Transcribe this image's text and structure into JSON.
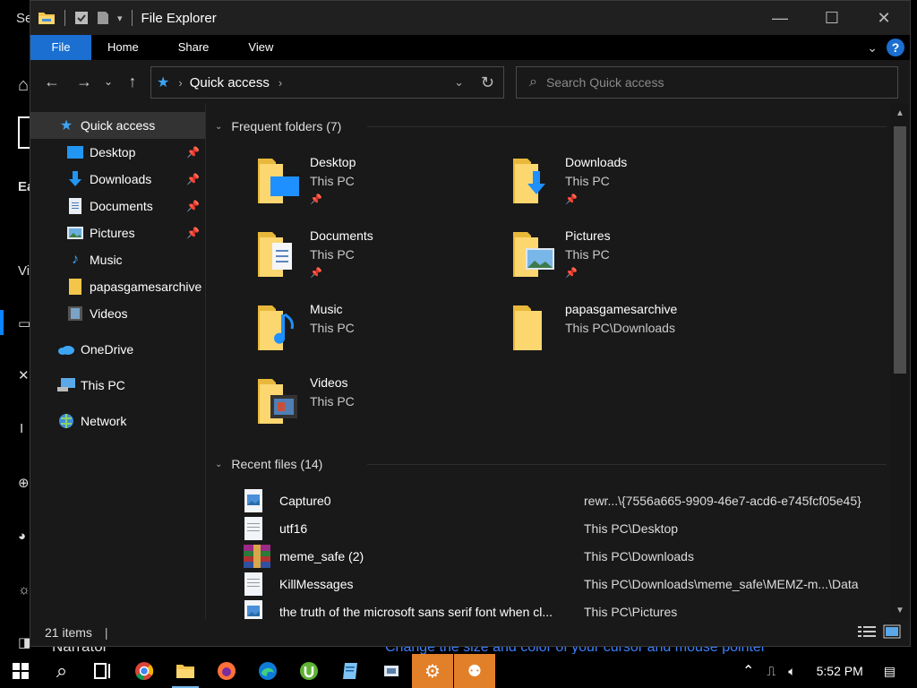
{
  "background": {
    "peek_labels": [
      "Se",
      "Ea",
      "Vi"
    ],
    "link_text": "Change the size and color of your cursor and mouse pointer",
    "narrator": "Narrator"
  },
  "window": {
    "title": "File Explorer",
    "ribbon_tabs": [
      "File",
      "Home",
      "Share",
      "View"
    ],
    "help_label": "?"
  },
  "address": {
    "crumb": "Quick access",
    "search_placeholder": "Search Quick access"
  },
  "sidebar": {
    "items": [
      {
        "label": "Quick access",
        "icon": "star-icon",
        "level": 0,
        "active": true,
        "pinned": false
      },
      {
        "label": "Desktop",
        "icon": "desktop-icon",
        "level": 1,
        "active": false,
        "pinned": true
      },
      {
        "label": "Downloads",
        "icon": "download-arrow-icon",
        "level": 1,
        "active": false,
        "pinned": true
      },
      {
        "label": "Documents",
        "icon": "document-icon",
        "level": 1,
        "active": false,
        "pinned": true
      },
      {
        "label": "Pictures",
        "icon": "pictures-icon",
        "level": 1,
        "active": false,
        "pinned": true
      },
      {
        "label": "Music",
        "icon": "music-note-icon",
        "level": 1,
        "active": false,
        "pinned": false
      },
      {
        "label": "papasgamesarchive",
        "icon": "folder-icon",
        "level": 1,
        "active": false,
        "pinned": false
      },
      {
        "label": "Videos",
        "icon": "film-icon",
        "level": 1,
        "active": false,
        "pinned": false
      },
      {
        "label": "OneDrive",
        "icon": "cloud-icon",
        "level": 0,
        "active": false,
        "pinned": false
      },
      {
        "label": "This PC",
        "icon": "computer-icon",
        "level": 0,
        "active": false,
        "pinned": false
      },
      {
        "label": "Network",
        "icon": "network-icon",
        "level": 0,
        "active": false,
        "pinned": false
      }
    ]
  },
  "frequent": {
    "heading": "Frequent folders (7)",
    "folders": [
      {
        "name": "Desktop",
        "location": "This PC",
        "pinned": true,
        "overlay": "desktop"
      },
      {
        "name": "Downloads",
        "location": "This PC",
        "pinned": true,
        "overlay": "download"
      },
      {
        "name": "Documents",
        "location": "This PC",
        "pinned": true,
        "overlay": "document"
      },
      {
        "name": "Pictures",
        "location": "This PC",
        "pinned": true,
        "overlay": "picture"
      },
      {
        "name": "Music",
        "location": "This PC",
        "pinned": false,
        "overlay": "music"
      },
      {
        "name": "papasgamesarchive",
        "location": "This PC\\Downloads",
        "pinned": false,
        "overlay": "none"
      },
      {
        "name": "Videos",
        "location": "This PC",
        "pinned": false,
        "overlay": "video"
      }
    ]
  },
  "recent": {
    "heading": "Recent files (14)",
    "files": [
      {
        "name": "Capture0",
        "path": "rewr...\\{7556a665-9909-46e7-acd6-e745fcf05e45}",
        "icon": "image-file-icon"
      },
      {
        "name": "utf16",
        "path": "This PC\\Desktop",
        "icon": "text-file-icon"
      },
      {
        "name": "meme_safe (2)",
        "path": "This PC\\Downloads",
        "icon": "archive-icon"
      },
      {
        "name": "KillMessages",
        "path": "This PC\\Downloads\\meme_safe\\MEMZ-m...\\Data",
        "icon": "text-file-icon"
      },
      {
        "name": "the truth of the microsoft sans serif font when cl...",
        "path": "This PC\\Pictures",
        "icon": "image-file-icon"
      }
    ]
  },
  "status": {
    "items": "21 items"
  },
  "taskbar": {
    "time": "5:52 PM"
  }
}
